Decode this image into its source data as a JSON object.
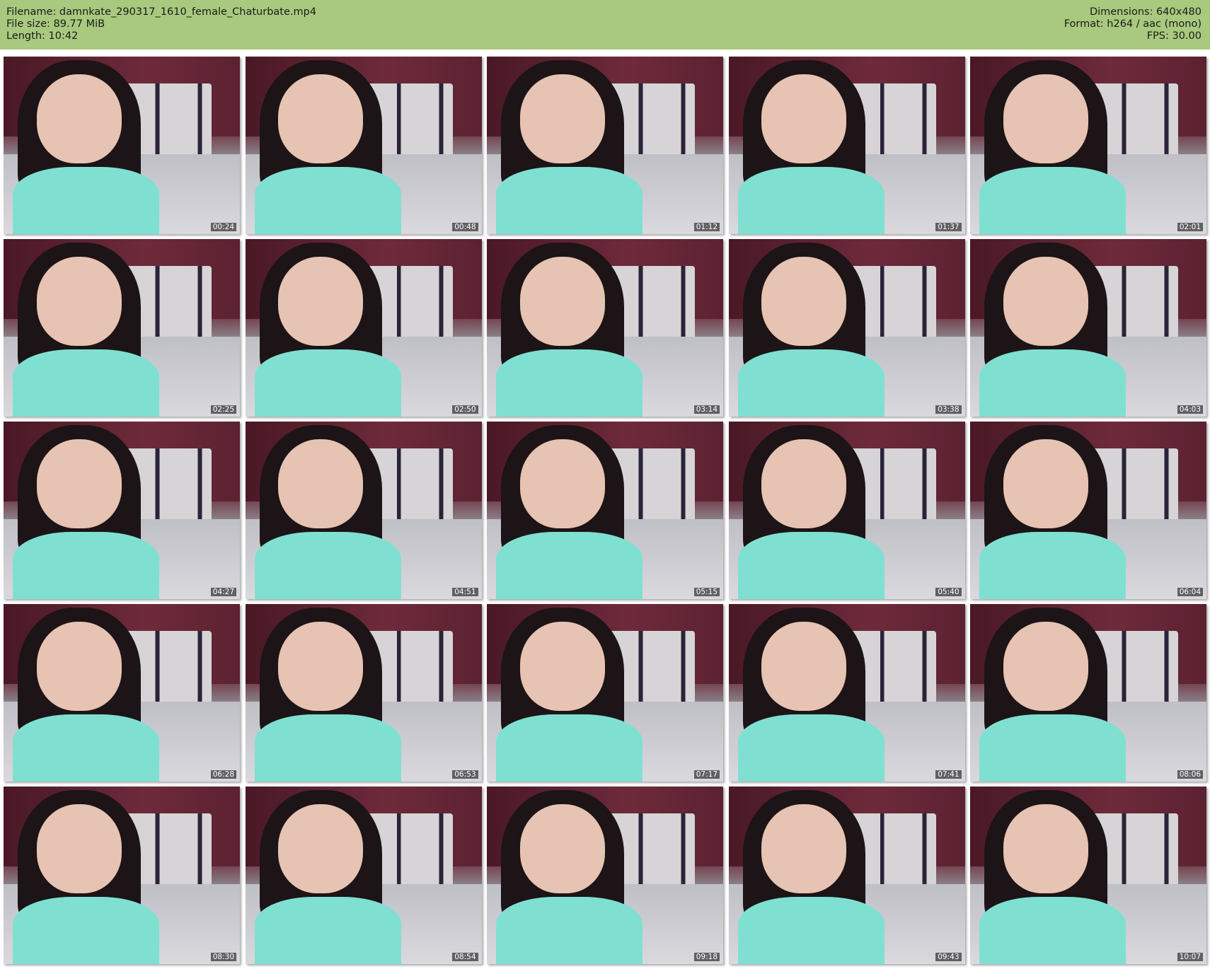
{
  "header": {
    "filename": "Filename: damnkate_290317_1610_female_Chaturbate.mp4",
    "filesize": "File size: 89.77 MiB",
    "length": "Length: 10:42",
    "dimensions": "Dimensions: 640x480",
    "format": "Format: h264 / aac (mono)",
    "fps": "FPS: 30.00"
  },
  "colors": {
    "header_bg": "#a9c97f"
  },
  "thumbnails": [
    "00:24",
    "00:48",
    "01:12",
    "01:37",
    "02:01",
    "02:25",
    "02:50",
    "03:14",
    "03:38",
    "04:03",
    "04:27",
    "04:51",
    "05:15",
    "05:40",
    "06:04",
    "06:28",
    "06:53",
    "07:17",
    "07:41",
    "08:06",
    "08:30",
    "08:54",
    "09:18",
    "09:43",
    "10:07"
  ]
}
